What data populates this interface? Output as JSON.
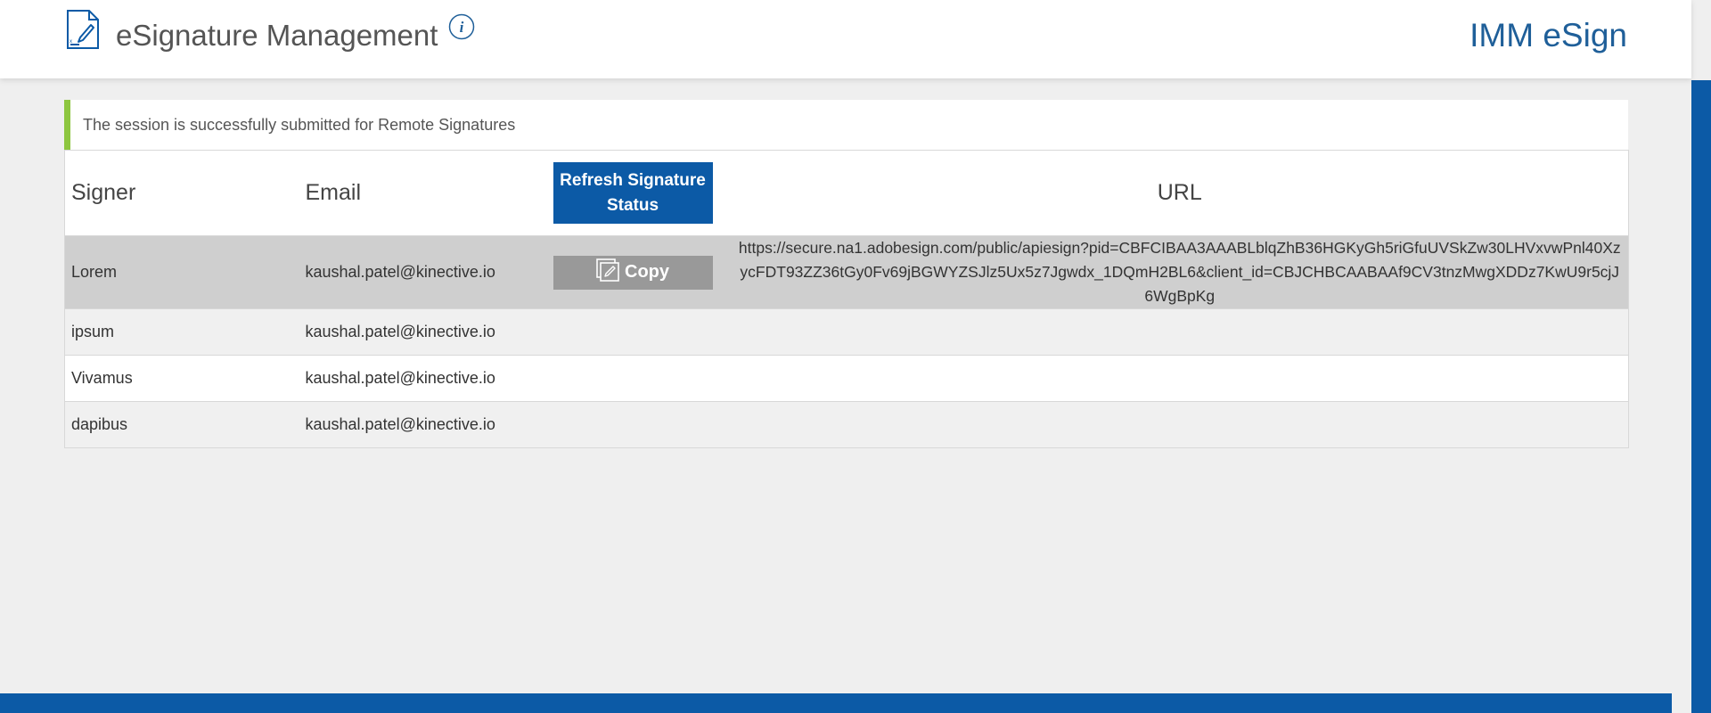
{
  "header": {
    "title": "eSignature Management",
    "brand": "IMM eSign",
    "icons": {
      "document": "document-signature-icon",
      "info": "info-icon"
    }
  },
  "alert": {
    "message": "The session is successfully submitted for Remote Signatures",
    "accent_color": "#8dc63f"
  },
  "table": {
    "columns": {
      "signer": "Signer",
      "email": "Email",
      "url": "URL"
    },
    "refresh_label": "Refresh Signature Status",
    "copy_label": "Copy",
    "rows": [
      {
        "signer": "Lorem",
        "email": "kaushal.patel@kinective.io",
        "url": "https://secure.na1.adobesign.com/public/apiesign?pid=CBFCIBAA3AAABLblqZhB36HGKyGh5riGfuUVSkZw30LHVxvwPnl40XzycFDT93ZZ36tGy0Fv69jBGWYZSJlz5Ux5z7Jgwdx_1DQmH2BL6&client_id=CBJCHBCAABAAf9CV3tnzMwgXDDz7KwU9r5cjJ6WgBpKg"
      },
      {
        "signer": "ipsum",
        "email": "kaushal.patel@kinective.io",
        "url": ""
      },
      {
        "signer": "Vivamus",
        "email": "kaushal.patel@kinective.io",
        "url": ""
      },
      {
        "signer": "dapibus",
        "email": "kaushal.patel@kinective.io",
        "url": ""
      }
    ]
  },
  "colors": {
    "primary": "#0c5aa6",
    "brand_text": "#1f5f99",
    "copy_button": "#999999",
    "selected_row": "#cfcfcf"
  }
}
